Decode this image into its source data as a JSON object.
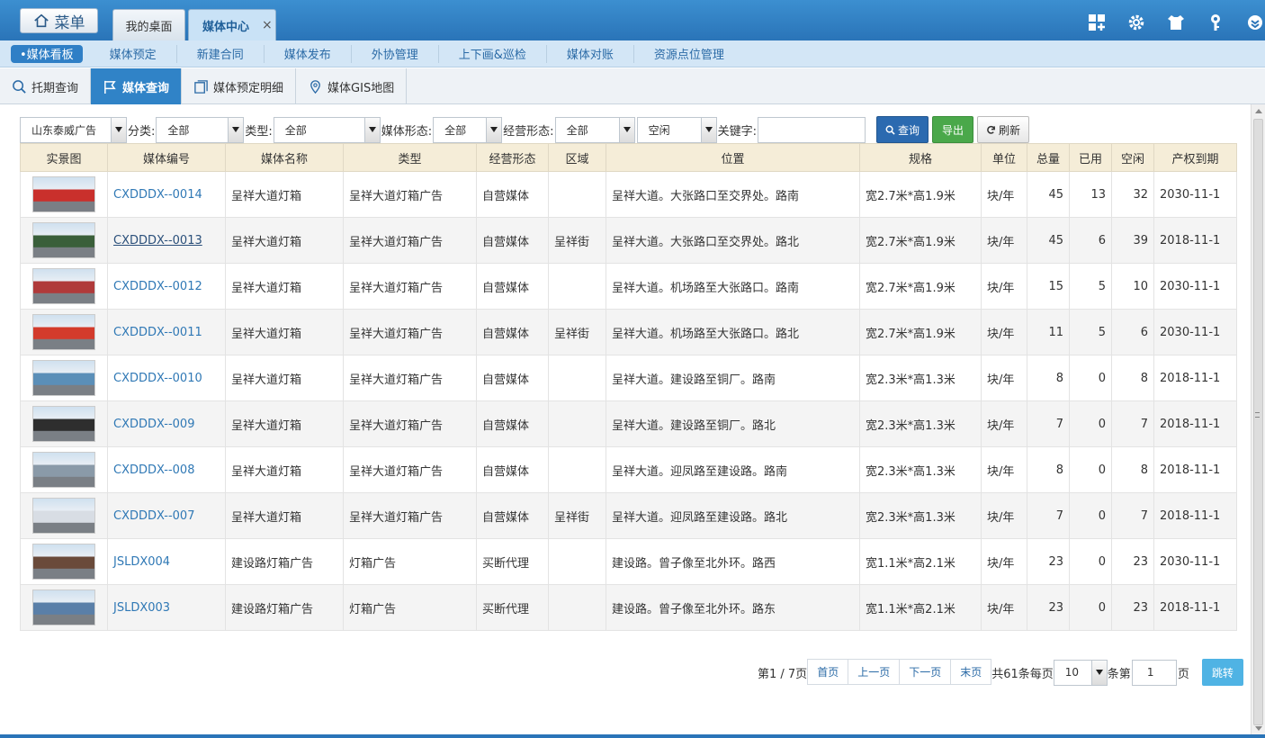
{
  "topbar": {
    "menu_label": "菜单",
    "tabs": [
      {
        "label": "我的桌面"
      },
      {
        "label": "媒体中心",
        "close": "×"
      }
    ],
    "icons": [
      "grid-plus-icon",
      "gear-icon",
      "shirt-icon",
      "key-icon",
      "chevron-icon"
    ]
  },
  "subnav": {
    "items": [
      {
        "label": "•媒体看板"
      },
      {
        "label": "媒体预定"
      },
      {
        "label": "新建合同"
      },
      {
        "label": "媒体发布"
      },
      {
        "label": "外协管理"
      },
      {
        "label": "上下画&巡检"
      },
      {
        "label": "媒体对账"
      },
      {
        "label": "资源点位管理"
      }
    ]
  },
  "tabbar": {
    "tabs": [
      {
        "label": "托期查询"
      },
      {
        "label": "媒体查询"
      },
      {
        "label": "媒体预定明细"
      },
      {
        "label": "媒体GIS地图"
      }
    ]
  },
  "filters": {
    "company": "山东泰威广告",
    "category_label": "分类:",
    "category_value": "全部",
    "type_label": "类型:",
    "type_value": "全部",
    "form_label": "媒体形态:",
    "form_value": "全部",
    "business_label": "经营形态:",
    "business_value": "全部",
    "status_value": "空闲",
    "keyword_label": "关键字:",
    "keyword_value": "",
    "query_btn": "查询",
    "export_btn": "导出",
    "refresh_btn": "刷新"
  },
  "table": {
    "headers": [
      "实景图",
      "媒体编号",
      "媒体名称",
      "类型",
      "经营形态",
      "区域",
      "位置",
      "规格",
      "单位",
      "总量",
      "已用",
      "空闲",
      "产权到期"
    ],
    "rows": [
      {
        "code": "CXDDDX--0014",
        "name": "呈祥大道灯箱",
        "type": "呈祥大道灯箱广告",
        "mode": "自营媒体",
        "area": "",
        "location": "呈祥大道。大张路口至交界处。路南",
        "spec": "宽2.7米*高1.9米",
        "unit": "块/年",
        "total": "45",
        "used": "13",
        "free": "32",
        "expire": "2030-11-1",
        "thumb": "#c9302c"
      },
      {
        "code": "CXDDDX--0013",
        "name": "呈祥大道灯箱",
        "type": "呈祥大道灯箱广告",
        "mode": "自营媒体",
        "area": "呈祥街",
        "location": "呈祥大道。大张路口至交界处。路北",
        "spec": "宽2.7米*高1.9米",
        "unit": "块/年",
        "total": "45",
        "used": "6",
        "free": "39",
        "expire": "2018-11-1",
        "thumb": "#3a5f3a"
      },
      {
        "code": "CXDDDX--0012",
        "name": "呈祥大道灯箱",
        "type": "呈祥大道灯箱广告",
        "mode": "自营媒体",
        "area": "",
        "location": "呈祥大道。机场路至大张路口。路南",
        "spec": "宽2.7米*高1.9米",
        "unit": "块/年",
        "total": "15",
        "used": "5",
        "free": "10",
        "expire": "2030-11-1",
        "thumb": "#b03a3a"
      },
      {
        "code": "CXDDDX--0011",
        "name": "呈祥大道灯箱",
        "type": "呈祥大道灯箱广告",
        "mode": "自营媒体",
        "area": "呈祥街",
        "location": "呈祥大道。机场路至大张路口。路北",
        "spec": "宽2.7米*高1.9米",
        "unit": "块/年",
        "total": "11",
        "used": "5",
        "free": "6",
        "expire": "2030-11-1",
        "thumb": "#d33b2c"
      },
      {
        "code": "CXDDDX--0010",
        "name": "呈祥大道灯箱",
        "type": "呈祥大道灯箱广告",
        "mode": "自营媒体",
        "area": "",
        "location": "呈祥大道。建设路至铜厂。路南",
        "spec": "宽2.3米*高1.3米",
        "unit": "块/年",
        "total": "8",
        "used": "0",
        "free": "8",
        "expire": "2018-11-1",
        "thumb": "#5b8fb8"
      },
      {
        "code": "CXDDDX--009",
        "name": "呈祥大道灯箱",
        "type": "呈祥大道灯箱广告",
        "mode": "自营媒体",
        "area": "",
        "location": "呈祥大道。建设路至铜厂。路北",
        "spec": "宽2.3米*高1.3米",
        "unit": "块/年",
        "total": "7",
        "used": "0",
        "free": "7",
        "expire": "2018-11-1",
        "thumb": "#2e2e2e"
      },
      {
        "code": "CXDDDX--008",
        "name": "呈祥大道灯箱",
        "type": "呈祥大道灯箱广告",
        "mode": "自营媒体",
        "area": "",
        "location": "呈祥大道。迎凤路至建设路。路南",
        "spec": "宽2.3米*高1.3米",
        "unit": "块/年",
        "total": "8",
        "used": "0",
        "free": "8",
        "expire": "2018-11-1",
        "thumb": "#8a9aa8"
      },
      {
        "code": "CXDDDX--007",
        "name": "呈祥大道灯箱",
        "type": "呈祥大道灯箱广告",
        "mode": "自营媒体",
        "area": "呈祥街",
        "location": "呈祥大道。迎凤路至建设路。路北",
        "spec": "宽2.3米*高1.3米",
        "unit": "块/年",
        "total": "7",
        "used": "0",
        "free": "7",
        "expire": "2018-11-1",
        "thumb": "#d8dde4"
      },
      {
        "code": "JSLDX004",
        "name": "建设路灯箱广告",
        "type": "灯箱广告",
        "mode": "买断代理",
        "area": "",
        "location": "建设路。曾子像至北外环。路西",
        "spec": "宽1.1米*高2.1米",
        "unit": "块/年",
        "total": "23",
        "used": "0",
        "free": "23",
        "expire": "2030-11-1",
        "thumb": "#6a4a3a"
      },
      {
        "code": "JSLDX003",
        "name": "建设路灯箱广告",
        "type": "灯箱广告",
        "mode": "买断代理",
        "area": "",
        "location": "建设路。曾子像至北外环。路东",
        "spec": "宽1.1米*高2.1米",
        "unit": "块/年",
        "total": "23",
        "used": "0",
        "free": "23",
        "expire": "2018-11-1",
        "thumb": "#5a7fa8"
      }
    ]
  },
  "pager": {
    "page_info": "第1 / 7页",
    "first": "首页",
    "prev": "上一页",
    "next": "下一页",
    "last": "末页",
    "total_text": "共61条每页",
    "page_size": "10",
    "goto_prefix": "条第",
    "goto_value": "1",
    "goto_suffix": "页",
    "go_btn": "跳转"
  }
}
